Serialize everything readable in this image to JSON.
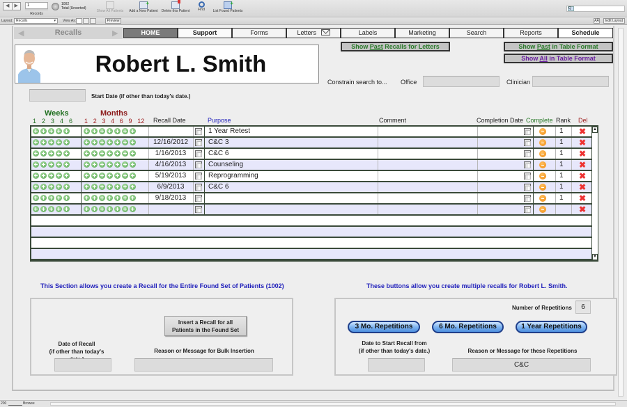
{
  "toolbar": {
    "record_number": "1",
    "records_label": "Records",
    "total_count": "1002",
    "total_label": "Total (Unsorted)",
    "show_all": "Show All Patients",
    "add_patient": "Add a New Patient",
    "delete_patient": "Delete this Patient",
    "find": "Find",
    "list_found": "List Found Patients"
  },
  "layoutbar": {
    "layout_label": "Layout:",
    "layout_value": "Recalls",
    "view_as_label": "View As:",
    "preview": "Preview",
    "aa": "AÂ",
    "edit_layout": "Edit Layout"
  },
  "nav": {
    "section_title": "Recalls",
    "tabs": [
      {
        "label": "HOME"
      },
      {
        "label": "Support"
      },
      {
        "label": "Forms"
      },
      {
        "label": "Letters"
      },
      {
        "label": "Labels"
      },
      {
        "label": "Marketing"
      },
      {
        "label": "Search"
      },
      {
        "label": "Reports"
      },
      {
        "label": "Schedule"
      }
    ]
  },
  "buttons": {
    "show_past_letters_pre": "Show ",
    "show_past_letters_u": "Past",
    "show_past_letters_post": " Recalls for Letters",
    "show_past_table_pre": "Show ",
    "show_past_table_u": "Past",
    "show_past_table_post": " in Table Format",
    "show_all_table_pre": "Show ",
    "show_all_table_u": "All",
    "show_all_table_post": " in Table Format"
  },
  "patient": {
    "name": "Robert L. Smith"
  },
  "filters": {
    "start_date_label": "Start Date (if other than today's date.)",
    "start_date_value": "",
    "constrain_label": "Constrain search  to...",
    "office_label": "Office",
    "office_value": "",
    "clinician_label": "Clinician",
    "clinician_value": ""
  },
  "table": {
    "weeks_label": "Weeks",
    "months_label": "Months",
    "weeks": [
      "1",
      "2",
      "3",
      "4",
      "6"
    ],
    "months": [
      "1",
      "2",
      "3",
      "4",
      "6",
      "9",
      "12"
    ],
    "columns": {
      "recall_date": "Recall Date",
      "purpose": "Purpose",
      "comment": "Comment",
      "completion_date": "Completion Date",
      "complete": "Complete",
      "rank": "Rank",
      "del": "Del"
    },
    "rows": [
      {
        "recall_date": "",
        "purpose": "1 Year Retest",
        "comment": "",
        "completion_date": "",
        "rank": "1"
      },
      {
        "recall_date": "12/16/2012",
        "purpose": "C&C 3",
        "comment": "",
        "completion_date": "",
        "rank": "1"
      },
      {
        "recall_date": "1/16/2013",
        "purpose": "C&C 6",
        "comment": "",
        "completion_date": "",
        "rank": "1"
      },
      {
        "recall_date": "4/16/2013",
        "purpose": "Counseling",
        "comment": "",
        "completion_date": "",
        "rank": "1"
      },
      {
        "recall_date": "5/19/2013",
        "purpose": "Reprogramming",
        "comment": "",
        "completion_date": "",
        "rank": "1"
      },
      {
        "recall_date": "6/9/2013",
        "purpose": "C&C 6",
        "comment": "",
        "completion_date": "",
        "rank": "1"
      },
      {
        "recall_date": "9/18/2013",
        "purpose": "",
        "comment": "",
        "completion_date": "",
        "rank": "1"
      },
      {
        "recall_date": "",
        "purpose": "",
        "comment": "",
        "completion_date": "",
        "rank": ""
      }
    ]
  },
  "bulk": {
    "title": "This Section allows you create a Recall for the Entire Found Set of Patients (1002)",
    "insert_button_line1": "Insert a Recall for all",
    "insert_button_line2": "Patients in the Found Set",
    "date_label_line1": "Date of Recall",
    "date_label_line2": "(if other than today's date.)",
    "date_value": "",
    "reason_label": "Reason or Message for Bulk Insertion",
    "reason_value": ""
  },
  "repetitions": {
    "title": "These buttons allow you create multiple recalls for Robert L. Smith.",
    "count_label": "Number of Repetitions",
    "count_value": "6",
    "btn_3mo": "3 Mo. Repetitions",
    "btn_6mo": "6 Mo. Repetitions",
    "btn_1yr": "1 Year Repetitions",
    "start_label_line1": "Date to Start Recall from",
    "start_label_line2": "(if other than today's date.)",
    "start_value": "",
    "reason_label": "Reason or Message for these Repetitions",
    "reason_value": "C&C"
  },
  "statusbar": {
    "zoom": "200",
    "mode": "Browse"
  },
  "colors": {
    "accent_blue": "#2222bb",
    "weeks_green": "#1e6e1e",
    "months_red": "#8b1a1a",
    "row_alt": "#e7e7fb",
    "delete_red": "#e33333"
  }
}
